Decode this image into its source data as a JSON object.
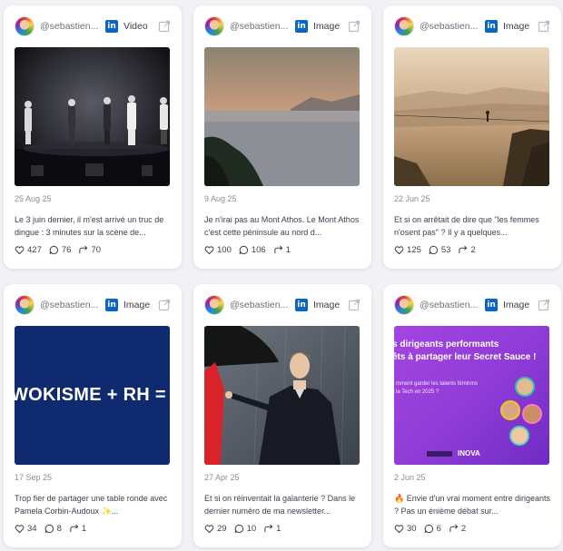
{
  "posts": [
    {
      "handle": "@sebastien...",
      "media_type": "Video",
      "date": "25 Aug 25",
      "caption": "Le 3 juin dernier, il m'est arrivé un truc de dingue : 3 minutes sur la scène de...",
      "likes": "427",
      "comments": "76",
      "reposts": "70",
      "image_text": ""
    },
    {
      "handle": "@sebastien...",
      "media_type": "Image",
      "date": "9 Aug 25",
      "caption": "Je n'irai pas au Mont Athos. Le Mont Athos c'est cette péninsule au nord d...",
      "likes": "100",
      "comments": "106",
      "reposts": "1",
      "image_text": ""
    },
    {
      "handle": "@sebastien...",
      "media_type": "Image",
      "date": "22 Jun 25",
      "caption": "Et si on arrêtait de dire que \"les femmes n'osent pas\" ? Il y a quelques...",
      "likes": "125",
      "comments": "53",
      "reposts": "2",
      "image_text": ""
    },
    {
      "handle": "@sebastien...",
      "media_type": "Image",
      "date": "17 Sep 25",
      "caption": "Trop fier de partager une table ronde avec Pamela Corbin-Audoux ✨...",
      "likes": "34",
      "comments": "8",
      "reposts": "1",
      "image_text": "WOKISME + RH = '"
    },
    {
      "handle": "@sebastien...",
      "media_type": "Image",
      "date": "27 Apr 25",
      "caption": "Et si on réinventait la galanterie ? Dans le dernier numéro de ma newsletter...",
      "likes": "29",
      "comments": "10",
      "reposts": "1",
      "image_text": ""
    },
    {
      "handle": "@sebastien...",
      "media_type": "Image",
      "date": "2 Jun 25",
      "caption": "🔥 Envie d'un vrai moment entre dirigeants ? Pas un énième débat sur...",
      "likes": "30",
      "comments": "6",
      "reposts": "2",
      "image_text": "s dirigeants performants\nêts à partager leur Secret Sauce !",
      "image_subtext": "mment garder les talents féminins\nla Tech en 2025 ?",
      "image_brand": "INOVA"
    }
  ],
  "colors": {
    "linkedin": "#0a66c2",
    "page_bg": "#f1f2f6",
    "card_bg": "#ffffff",
    "navy_banner": "#0f2a6e",
    "purple_banner": "#8e3bd6"
  }
}
